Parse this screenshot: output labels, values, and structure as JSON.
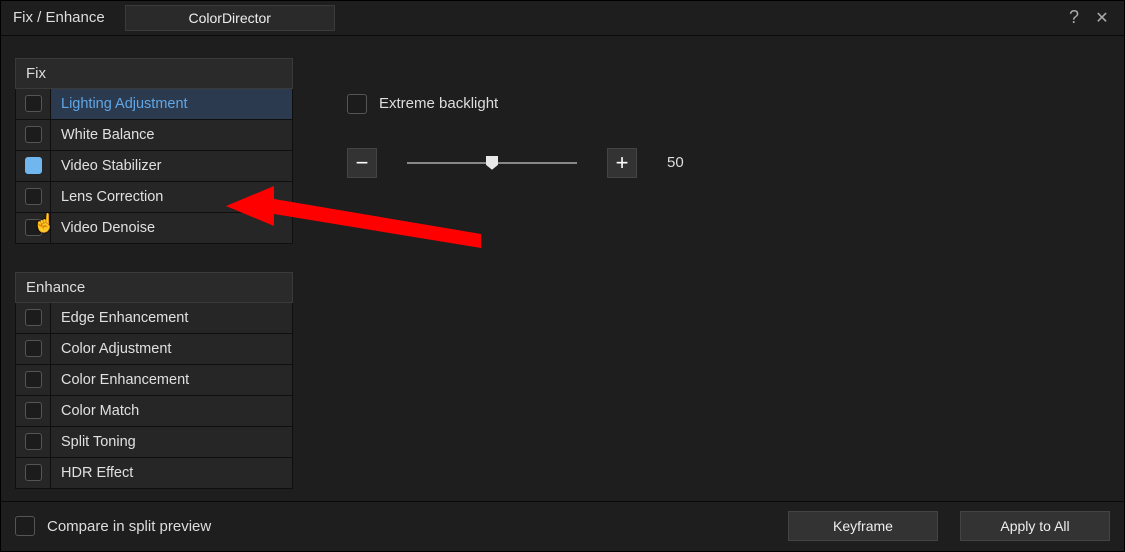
{
  "titlebar": {
    "title": "Fix / Enhance",
    "colordirector": "ColorDirector"
  },
  "sections": {
    "fix": {
      "header": "Fix",
      "items": [
        {
          "label": "Lighting Adjustment",
          "checked": false,
          "selected": true
        },
        {
          "label": "White Balance",
          "checked": false,
          "selected": false
        },
        {
          "label": "Video Stabilizer",
          "checked": true,
          "selected": false
        },
        {
          "label": "Lens Correction",
          "checked": false,
          "selected": false
        },
        {
          "label": "Video Denoise",
          "checked": false,
          "selected": false
        }
      ]
    },
    "enhance": {
      "header": "Enhance",
      "items": [
        {
          "label": "Edge Enhancement",
          "checked": false,
          "selected": false
        },
        {
          "label": "Color Adjustment",
          "checked": false,
          "selected": false
        },
        {
          "label": "Color Enhancement",
          "checked": false,
          "selected": false
        },
        {
          "label": "Color Match",
          "checked": false,
          "selected": false
        },
        {
          "label": "Split Toning",
          "checked": false,
          "selected": false
        },
        {
          "label": "HDR Effect",
          "checked": false,
          "selected": false
        }
      ]
    }
  },
  "main": {
    "extreme_backlight_label": "Extreme backlight",
    "slider_value": "50",
    "minus": "−",
    "plus": "+"
  },
  "footer": {
    "compare_label": "Compare in split preview",
    "keyframe": "Keyframe",
    "apply_all": "Apply to All"
  },
  "annotation": {
    "arrow_color": "#ff0000"
  }
}
